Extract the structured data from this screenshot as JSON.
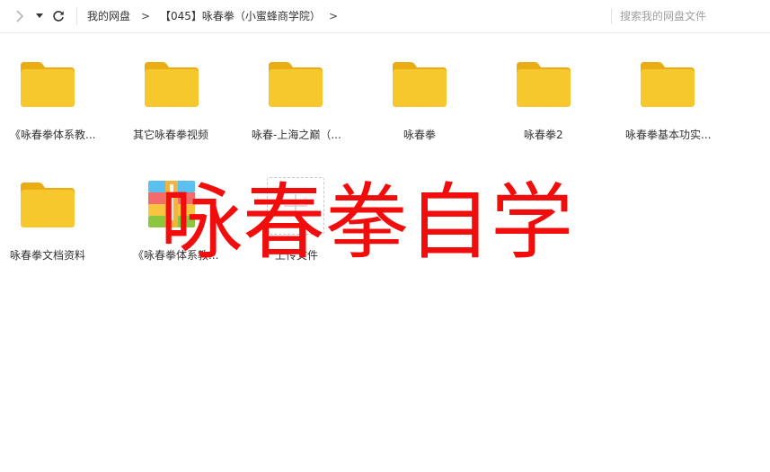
{
  "toolbar": {
    "breadcrumbs": [
      "我的网盘",
      "【045】咏春拳（小蜜蜂商学院）"
    ],
    "separator": ">",
    "search_placeholder": "搜索我的网盘文件"
  },
  "items": [
    {
      "name": "《咏春拳体系教...",
      "type": "folder"
    },
    {
      "name": "其它咏春拳视频",
      "type": "folder"
    },
    {
      "name": "咏春-上海之巅（...",
      "type": "folder"
    },
    {
      "name": "咏春拳",
      "type": "folder"
    },
    {
      "name": "咏春拳2",
      "type": "folder"
    },
    {
      "name": "咏春拳基本功实...",
      "type": "folder"
    },
    {
      "name": "咏春拳文档资料",
      "type": "folder"
    },
    {
      "name": "《咏春拳体系教...",
      "type": "archive"
    }
  ],
  "upload": {
    "label": "上传文件"
  },
  "watermark": {
    "text": "咏春拳自学"
  },
  "colors": {
    "folder_front": "#f7c72e",
    "folder_back": "#e9ac13",
    "watermark": "#f20d0d",
    "archive_stripes": [
      "#5bc0f0",
      "#f36b6b",
      "#f7c540",
      "#8cc63f"
    ]
  }
}
